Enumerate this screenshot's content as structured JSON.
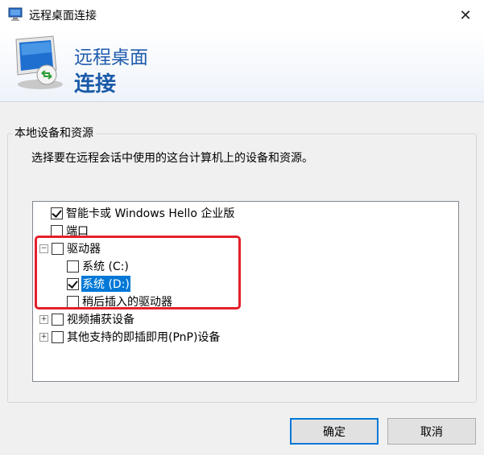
{
  "window": {
    "title": "远程桌面连接",
    "close_glyph": "✕"
  },
  "banner": {
    "line1": "远程桌面",
    "line2": "连接"
  },
  "group": {
    "title": "本地设备和资源",
    "description": "选择要在远程会话中使用的这台计算机上的设备和资源。"
  },
  "tree": {
    "items": [
      {
        "label": "智能卡或 Windows Hello 企业版",
        "checked": true,
        "expander": "none"
      },
      {
        "label": "端口",
        "checked": false,
        "expander": "none"
      },
      {
        "label": "驱动器",
        "checked": false,
        "expander": "collapse"
      },
      {
        "label": "系统 (C:)",
        "checked": false,
        "expander": "none",
        "child": true
      },
      {
        "label": "系统 (D:)",
        "checked": true,
        "expander": "none",
        "child": true,
        "selected": true
      },
      {
        "label": "稍后插入的驱动器",
        "checked": false,
        "expander": "none",
        "child": true
      },
      {
        "label": "视频捕获设备",
        "checked": false,
        "expander": "expand"
      },
      {
        "label": "其他支持的即插即用(PnP)设备",
        "checked": false,
        "expander": "expand"
      }
    ]
  },
  "buttons": {
    "ok": "确定",
    "cancel": "取消"
  },
  "colors": {
    "banner_text": "#1f5cac",
    "selection": "#0078d7",
    "highlight_box": "#e4202a"
  }
}
